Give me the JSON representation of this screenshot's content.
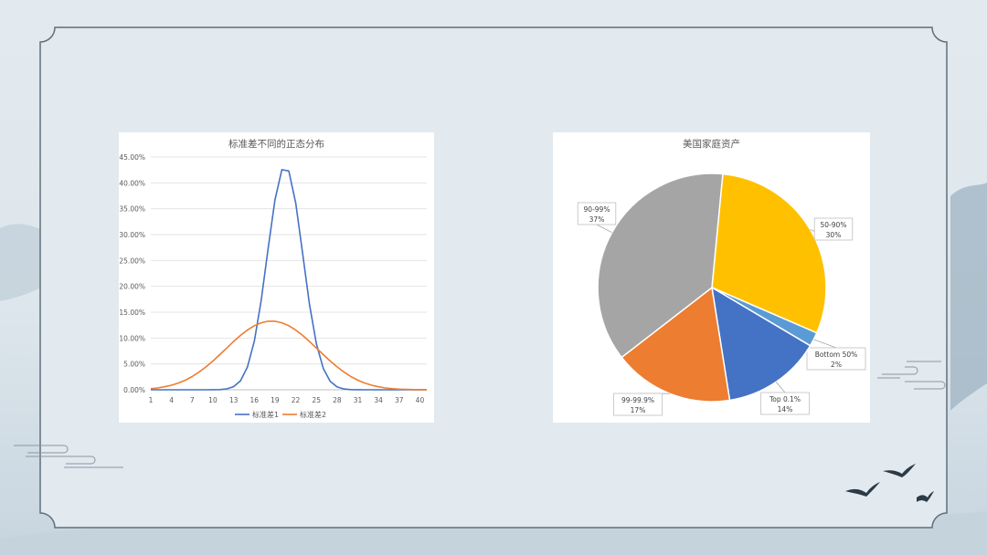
{
  "colors": {
    "series1": "#4472c4",
    "series2": "#ed7d31",
    "pie": [
      "#ffc000",
      "#5b9bd5",
      "#4472c4",
      "#ed7d31",
      "#a5a5a5"
    ],
    "frame": "#5f6f7c",
    "ink": "#2c3a45"
  },
  "chart_data": [
    {
      "type": "line",
      "title": "标准差不同的正态分布",
      "x": [
        1,
        2,
        3,
        4,
        5,
        6,
        7,
        8,
        9,
        10,
        11,
        12,
        13,
        14,
        15,
        16,
        17,
        18,
        19,
        20,
        21,
        22,
        23,
        24,
        25,
        26,
        27,
        28,
        29,
        30,
        31,
        32,
        33,
        34,
        35,
        36,
        37,
        38,
        39,
        40,
        41
      ],
      "x_tick_labels": [
        "1",
        "4",
        "7",
        "10",
        "13",
        "16",
        "19",
        "22",
        "25",
        "28",
        "31",
        "34",
        "37",
        "40"
      ],
      "ylim": [
        0,
        0.45
      ],
      "y_tick_labels": [
        "0.00%",
        "5.00%",
        "10.00%",
        "15.00%",
        "20.00%",
        "25.00%",
        "30.00%",
        "35.00%",
        "40.00%",
        "45.00%"
      ],
      "grid": true,
      "legend": "bottom",
      "series": [
        {
          "name": "标准差1",
          "color": "#4472c4",
          "values": [
            0,
            0,
            0,
            0,
            0,
            0,
            0,
            0,
            0,
            0.0001,
            0.0004,
            0.0018,
            0.006,
            0.0175,
            0.0438,
            0.094,
            0.1727,
            0.272,
            0.3675,
            0.4255,
            0.423,
            0.361,
            0.264,
            0.1655,
            0.089,
            0.041,
            0.0162,
            0.0055,
            0.0016,
            0.0004,
            0.0001,
            0,
            0,
            0,
            0,
            0,
            0,
            0,
            0,
            0,
            0
          ]
        },
        {
          "name": "标准差2",
          "color": "#ed7d31",
          "values": [
            0.0022,
            0.0036,
            0.0058,
            0.0088,
            0.013,
            0.0185,
            0.0256,
            0.0342,
            0.0443,
            0.0556,
            0.0679,
            0.0807,
            0.0933,
            0.1052,
            0.1155,
            0.1238,
            0.1296,
            0.1325,
            0.1325,
            0.1296,
            0.1238,
            0.1155,
            0.1052,
            0.0933,
            0.0807,
            0.0679,
            0.0556,
            0.0443,
            0.0342,
            0.0256,
            0.0185,
            0.013,
            0.0088,
            0.0058,
            0.0036,
            0.0022,
            0.0013,
            0.0007,
            0.0004,
            0.0002,
            0.0001
          ]
        }
      ]
    },
    {
      "type": "pie",
      "title": "美国家庭资产",
      "slices": [
        {
          "label": "50-90%",
          "pct": "30%",
          "value": 30,
          "color": "#ffc000"
        },
        {
          "label": "Bottom 50%",
          "pct": "2%",
          "value": 2,
          "color": "#5b9bd5"
        },
        {
          "label": "Top 0.1%",
          "pct": "14%",
          "value": 14,
          "color": "#4472c4"
        },
        {
          "label": "99-99.9%",
          "pct": "17%",
          "value": 17,
          "color": "#ed7d31"
        },
        {
          "label": "90-99%",
          "pct": "37%",
          "value": 37,
          "color": "#a5a5a5"
        }
      ]
    }
  ]
}
